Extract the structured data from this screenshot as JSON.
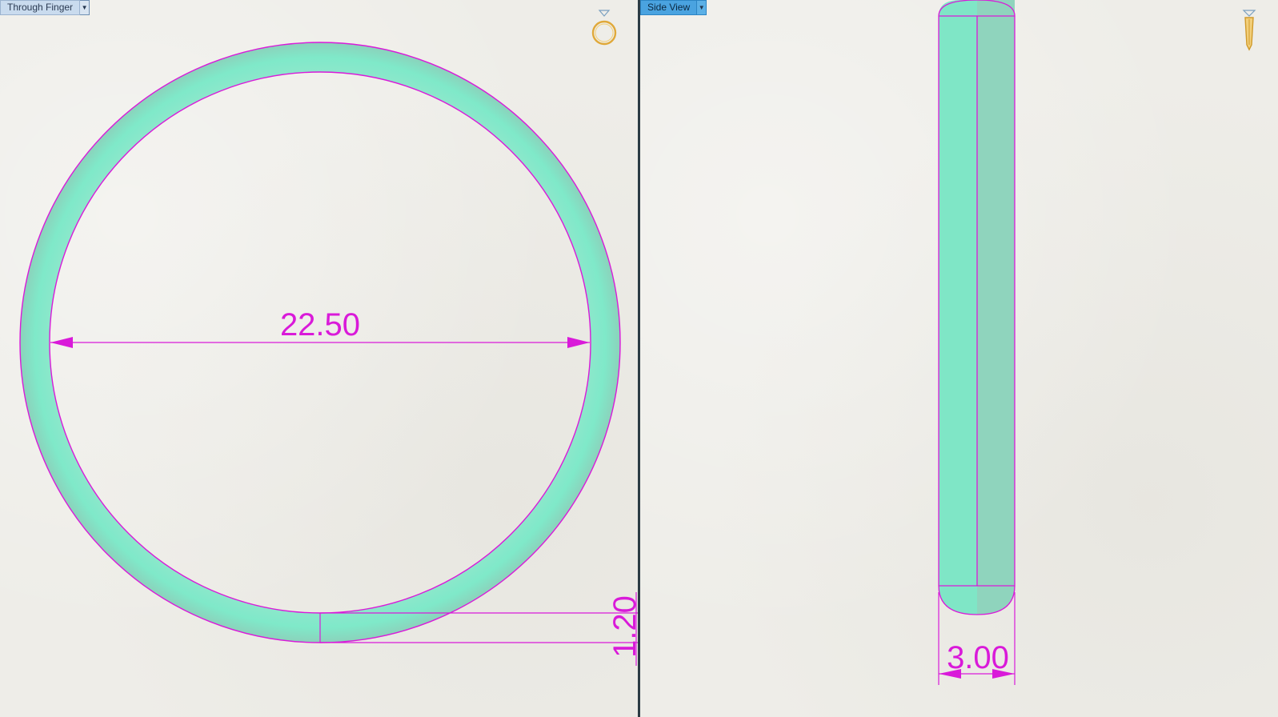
{
  "left_view": {
    "tab_label": "Through Finger",
    "view_icon": "ring-icon",
    "dimension_diameter": "22.50",
    "dimension_thickness": "1.20"
  },
  "right_view": {
    "tab_label": "Side View",
    "view_icon": "ring-side-icon",
    "dimension_width": "3.00"
  },
  "colors": {
    "band_fill": "#7ee6c6",
    "band_shade": "#8fd4bd",
    "dimension_line": "#d91ad9",
    "tab_active": "#4aa3e0",
    "tab_inactive": "#c9dbee",
    "icon_gold": "#e0a93a",
    "divider": "#2b3b44"
  }
}
